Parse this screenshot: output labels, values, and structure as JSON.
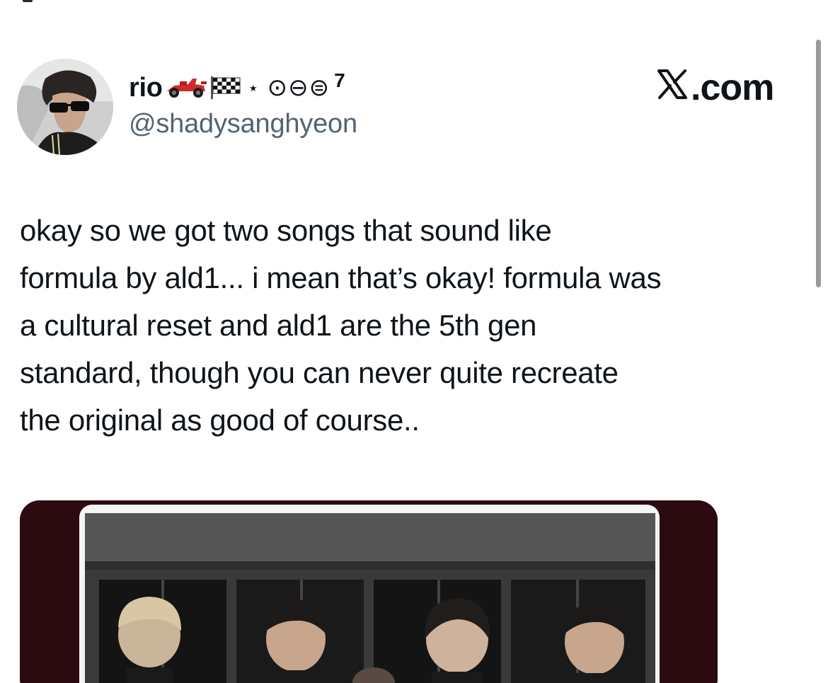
{
  "tweet": {
    "author": {
      "name": "rio",
      "name_decorations": {
        "star": "⋆",
        "circles": "⊙⊖⊜",
        "superscript": "7"
      },
      "handle": "@shadysanghyeon"
    },
    "brand": "X.com",
    "text_lines": [
      "okay so we got two songs that sound like",
      "formula by ald1... i mean that’s okay! formula was",
      "a cultural reset and ald1 are the 5th gen",
      "standard, though you can never quite recreate",
      "the original as good of course.."
    ]
  },
  "icons": {
    "avatar": "profile-photo",
    "race_car": "race-car-emoji",
    "checkered_flag": "checkered-flag-emoji",
    "brand_logo": "x-logo"
  },
  "colors": {
    "text_primary": "#0f1419",
    "text_secondary": "#536471",
    "media_frame": "#2a0a0e",
    "race_car": "#d22a2a"
  }
}
